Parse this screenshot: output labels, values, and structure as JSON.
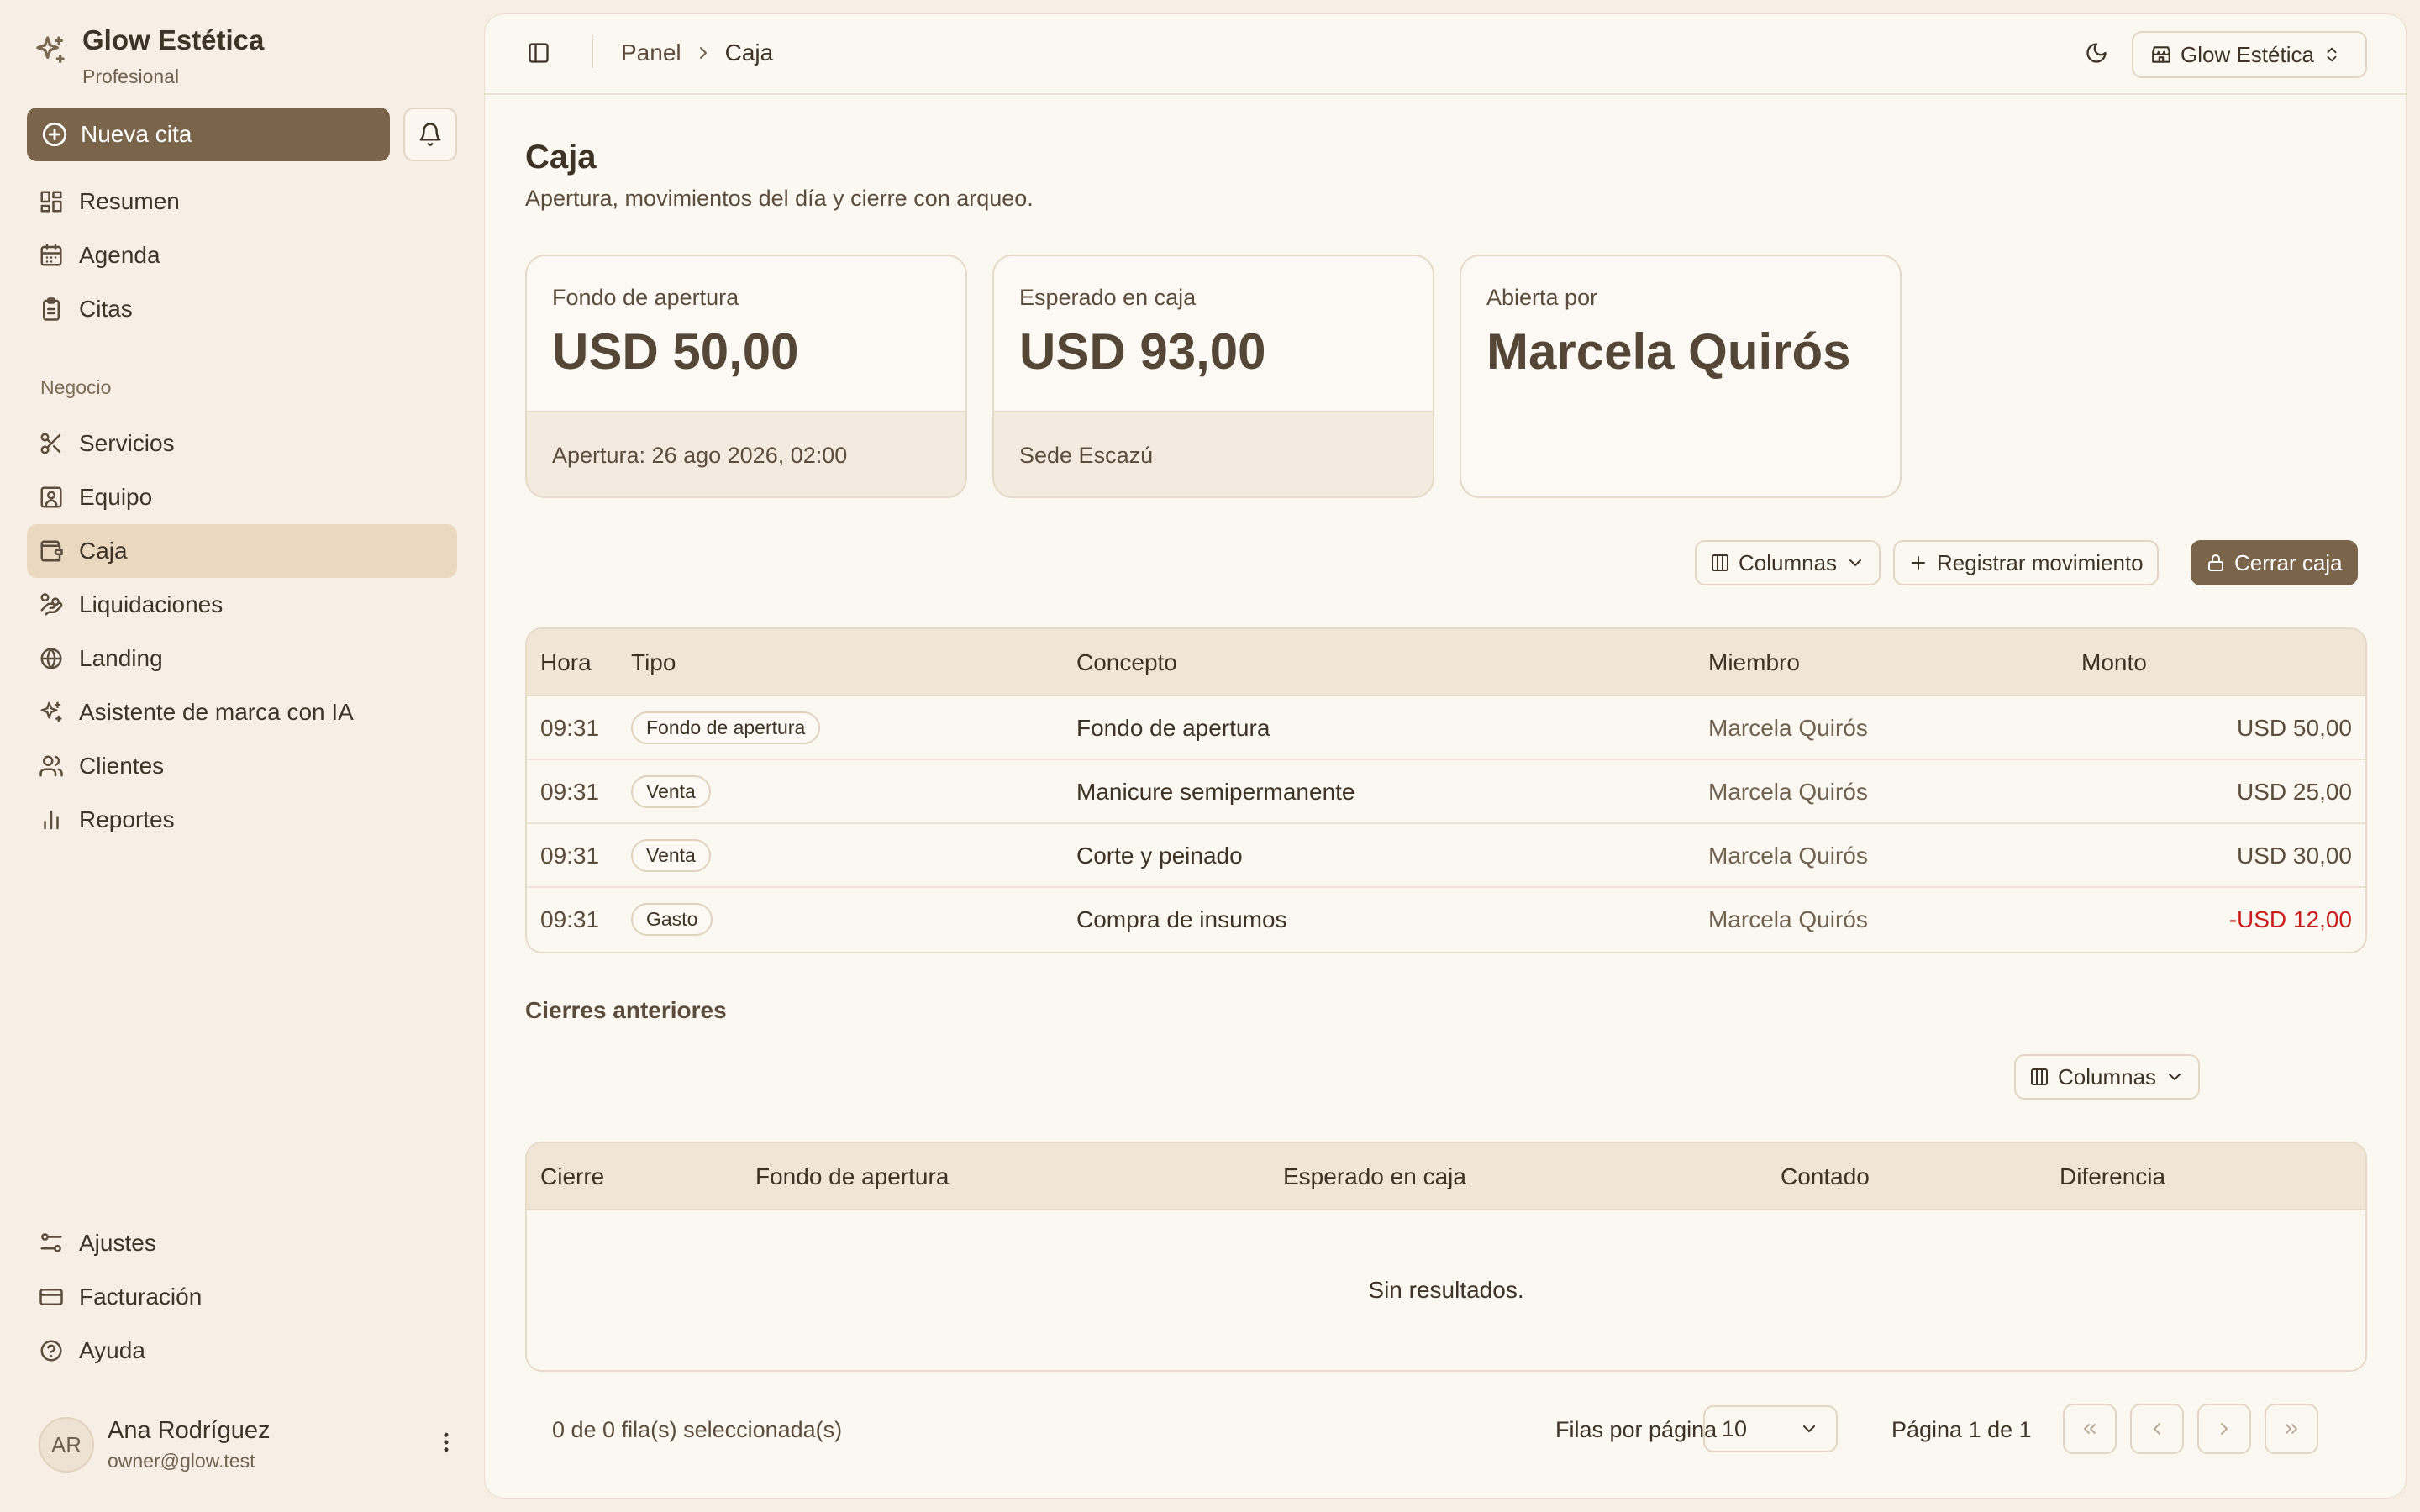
{
  "brand": {
    "name": "Glow Estética",
    "plan": "Profesional"
  },
  "sidebar": {
    "new_appointment": "Nueva cita",
    "main_items": [
      {
        "label": "Resumen",
        "icon": "dashboard-icon"
      },
      {
        "label": "Agenda",
        "icon": "calendar-icon"
      },
      {
        "label": "Citas",
        "icon": "clipboard-icon"
      }
    ],
    "group_label": "Negocio",
    "business_items": [
      {
        "label": "Servicios",
        "icon": "scissors-icon"
      },
      {
        "label": "Equipo",
        "icon": "id-badge-icon"
      },
      {
        "label": "Caja",
        "icon": "wallet-icon",
        "active": true
      },
      {
        "label": "Liquidaciones",
        "icon": "hand-coins-icon"
      },
      {
        "label": "Landing",
        "icon": "globe-icon"
      },
      {
        "label": "Asistente de marca con IA",
        "icon": "sparkles-icon"
      },
      {
        "label": "Clientes",
        "icon": "users-icon"
      },
      {
        "label": "Reportes",
        "icon": "bar-chart-icon"
      }
    ],
    "bottom_items": [
      {
        "label": "Ajustes",
        "icon": "settings-sliders-icon"
      },
      {
        "label": "Facturación",
        "icon": "credit-card-icon"
      },
      {
        "label": "Ayuda",
        "icon": "help-circle-icon"
      }
    ],
    "user": {
      "initials": "AR",
      "name": "Ana Rodríguez",
      "email": "owner@glow.test"
    }
  },
  "topbar": {
    "breadcrumb": {
      "parent": "Panel",
      "current": "Caja"
    },
    "store_selector": "Glow Estética"
  },
  "page": {
    "title": "Caja",
    "subtitle": "Apertura, movimientos del día y cierre con arqueo."
  },
  "cards": {
    "opening": {
      "label": "Fondo de apertura",
      "value": "USD 50,00",
      "foot": "Apertura: 26 ago 2026, 02:00"
    },
    "expected": {
      "label": "Esperado en caja",
      "value": "USD 93,00",
      "foot": "Sede Escazú"
    },
    "opened_by": {
      "label": "Abierta por",
      "value": "Marcela Quirós"
    }
  },
  "actions": {
    "columns": "Columnas",
    "register": "Registrar movimiento",
    "close": "Cerrar caja"
  },
  "movements": {
    "headers": {
      "hora": "Hora",
      "tipo": "Tipo",
      "concepto": "Concepto",
      "miembro": "Miembro",
      "monto": "Monto"
    },
    "rows": [
      {
        "hora": "09:31",
        "tipo": "Fondo de apertura",
        "concepto": "Fondo de apertura",
        "miembro": "Marcela Quirós",
        "monto": "USD 50,00"
      },
      {
        "hora": "09:31",
        "tipo": "Venta",
        "concepto": "Manicure semipermanente",
        "miembro": "Marcela Quirós",
        "monto": "USD 25,00"
      },
      {
        "hora": "09:31",
        "tipo": "Venta",
        "concepto": "Corte y peinado",
        "miembro": "Marcela Quirós",
        "monto": "USD 30,00"
      },
      {
        "hora": "09:31",
        "tipo": "Gasto",
        "concepto": "Compra de insumos",
        "miembro": "Marcela Quirós",
        "monto": "-USD 12,00"
      }
    ],
    "negative_color": "#c81e1e"
  },
  "closures": {
    "title": "Cierres anteriores",
    "columns_button": "Columnas",
    "headers": {
      "cierre": "Cierre",
      "fondo": "Fondo de apertura",
      "esperado": "Esperado en caja",
      "contado": "Contado",
      "diferencia": "Diferencia"
    },
    "empty": "Sin resultados."
  },
  "pagination": {
    "selected": "0 de 0 fila(s) seleccionada(s)",
    "rows_per_page_label": "Filas por página",
    "rows_per_page": "10",
    "page_info": "Página 1 de 1"
  },
  "colors": {
    "accent": "#7a654b",
    "active_nav": "#ead8c1",
    "background": "#f7efe5",
    "panel": "#fbf7f1"
  }
}
